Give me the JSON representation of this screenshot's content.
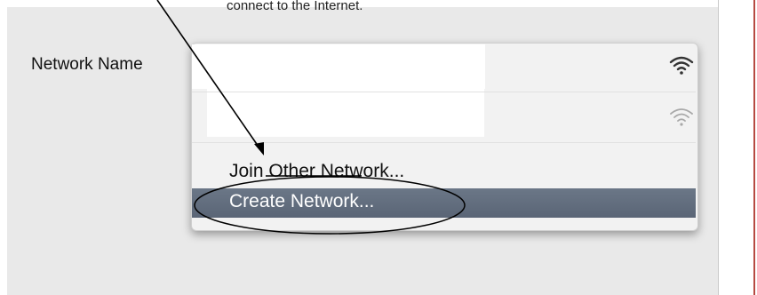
{
  "pane": {
    "help_text": "connect to the Internet.",
    "network_name_label": "Network Name"
  },
  "menu": {
    "items": [
      {
        "label": "",
        "icon": "wifi-strong-icon"
      },
      {
        "label": "",
        "icon": "wifi-weak-icon"
      },
      {
        "label": "Join Other Network..."
      },
      {
        "label": "Create Network...",
        "highlighted": true
      }
    ]
  },
  "colors": {
    "pane_background": "#e9e9e9",
    "menu_background": "#f2f2f2",
    "highlight": "#5f6a7b",
    "annotation_ink": "#000000"
  }
}
